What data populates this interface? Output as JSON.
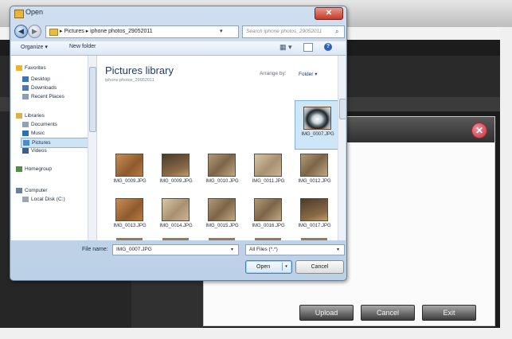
{
  "dialog": {
    "title": "Open",
    "close_glyph": "✕",
    "back_glyph": "◀",
    "forward_glyph": "▶",
    "address": "▸ Pictures ▸ iphone photos_29052011",
    "address_dropdown": "▾",
    "refresh_glyph": "↻",
    "search_placeholder": "Search iphone photos_29052011",
    "search_icon": "search-icon",
    "toolbar": {
      "organize": "Organize ▾",
      "new_folder": "New folder",
      "views_glyph": "▦ ▾",
      "help_glyph": "?"
    }
  },
  "nav": {
    "items": [
      {
        "label": "Favorites",
        "color": "#e5b634"
      },
      {
        "label": "Desktop",
        "color": "#3f73b8"
      },
      {
        "label": "Downloads",
        "color": "#4b78b8"
      },
      {
        "label": "Recent Places",
        "color": "#8e9db0"
      },
      {
        "label": "Libraries",
        "color": "#d9b24c"
      },
      {
        "label": "Documents",
        "color": "#8da2bb"
      },
      {
        "label": "Music",
        "color": "#2e6fb0"
      },
      {
        "label": "Pictures",
        "color": "#4a8ad0"
      },
      {
        "label": "Videos",
        "color": "#3a5f8f"
      },
      {
        "label": "Homegroup",
        "color": "#4f8f3f"
      },
      {
        "label": "Computer",
        "color": "#6a7f98"
      },
      {
        "label": "Local Disk (C:)",
        "color": "#9aa6b4"
      }
    ],
    "selected": "Pictures"
  },
  "content": {
    "title": "Pictures library",
    "subtitle": "iphone photos_29052011",
    "arrange_label": "Arrange by:",
    "arrange_value": "Folder ▾",
    "files": [
      {
        "name": "IMG_0007.JPG",
        "kind": "cam",
        "selected": true
      },
      {
        "name": "IMG_0009.JPG",
        "kind": "orange"
      },
      {
        "name": "IMG_0009.JPG",
        "kind": "dark"
      },
      {
        "name": "IMG_0010.JPG",
        "kind": "wall"
      },
      {
        "name": "IMG_0011.JPG",
        "kind": "light"
      },
      {
        "name": "IMG_0012.JPG",
        "kind": "wall"
      },
      {
        "name": "IMG_0013.JPG",
        "kind": "orange"
      },
      {
        "name": "IMG_0014.JPG",
        "kind": "light"
      },
      {
        "name": "IMG_0015.JPG",
        "kind": "wall"
      },
      {
        "name": "IMG_0016.JPG",
        "kind": "wall"
      },
      {
        "name": "IMG_0017.JPG",
        "kind": "dark"
      }
    ]
  },
  "bottom": {
    "file_name_label": "File name:",
    "file_name_value": "IMG_0007.JPG",
    "file_type_value": "All Files (*.*)",
    "dropdown_glyph": "▾",
    "open_label": "Open",
    "open_split_glyph": "▾",
    "cancel_label": "Cancel"
  },
  "upload_dialog": {
    "close_glyph": "✕",
    "upload_label": "Upload",
    "cancel_label": "Cancel",
    "exit_label": "Exit"
  }
}
